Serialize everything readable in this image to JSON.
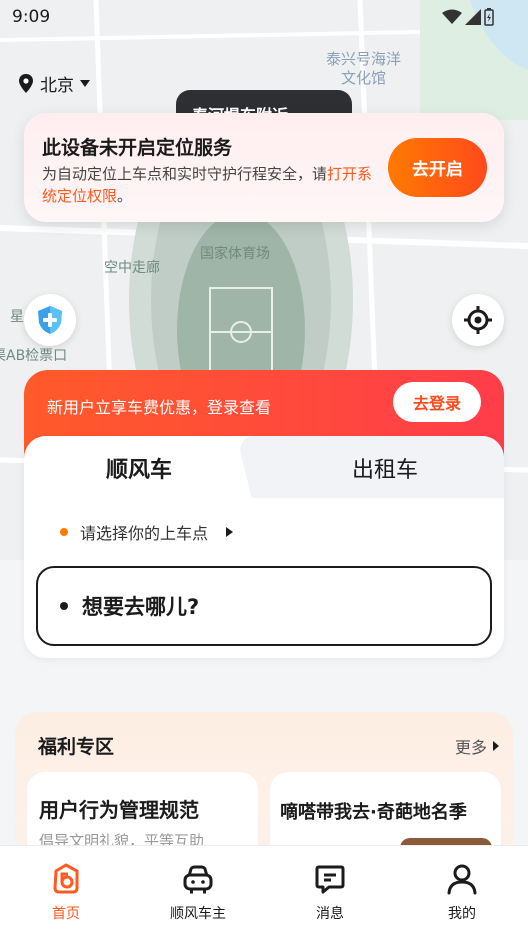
{
  "status_bar": {
    "time": "9:09"
  },
  "city": {
    "name": "北京"
  },
  "map": {
    "labels": {
      "museum": "泰兴号海洋\n文化馆",
      "stadium": "国家体育场",
      "corridor": "空中走廊",
      "left_edge_top": "星",
      "gate": "渠AB检票口"
    },
    "dark_tip": "春河堤东附近"
  },
  "location_banner": {
    "title": "此设备未开启定位服务",
    "desc_prefix": "为自动定位上车点和实时守护行程安全，请",
    "desc_link": "打开系统定位权限",
    "desc_suffix": "。",
    "button": "去开启"
  },
  "promo": {
    "text": "新用户立享车费优惠，登录查看",
    "button": "去登录"
  },
  "booking": {
    "tabs": [
      {
        "label": "顺风车",
        "active": true
      },
      {
        "label": "出租车",
        "active": false
      }
    ],
    "pickup_hint": "请选择你的上车点",
    "destination_placeholder": "想要去哪儿?"
  },
  "welfare": {
    "title": "福利专区",
    "more": "更多",
    "cards": [
      {
        "title": "用户行为管理规范",
        "subtitle": "倡导文明礼貌，平等互助"
      },
      {
        "title": "嘀嗒带我去·奇葩地名季",
        "subtitle": ""
      }
    ]
  },
  "bottom_nav": {
    "items": [
      {
        "label": "首页",
        "icon": "home-icon",
        "active": true
      },
      {
        "label": "顺风车主",
        "icon": "car-owner-icon",
        "active": false
      },
      {
        "label": "消息",
        "icon": "message-icon",
        "active": false
      },
      {
        "label": "我的",
        "icon": "profile-icon",
        "active": false
      }
    ]
  },
  "colors": {
    "accent": "#ff5a1f",
    "promo_start": "#ff5a2a",
    "promo_end": "#ff3d4a"
  }
}
